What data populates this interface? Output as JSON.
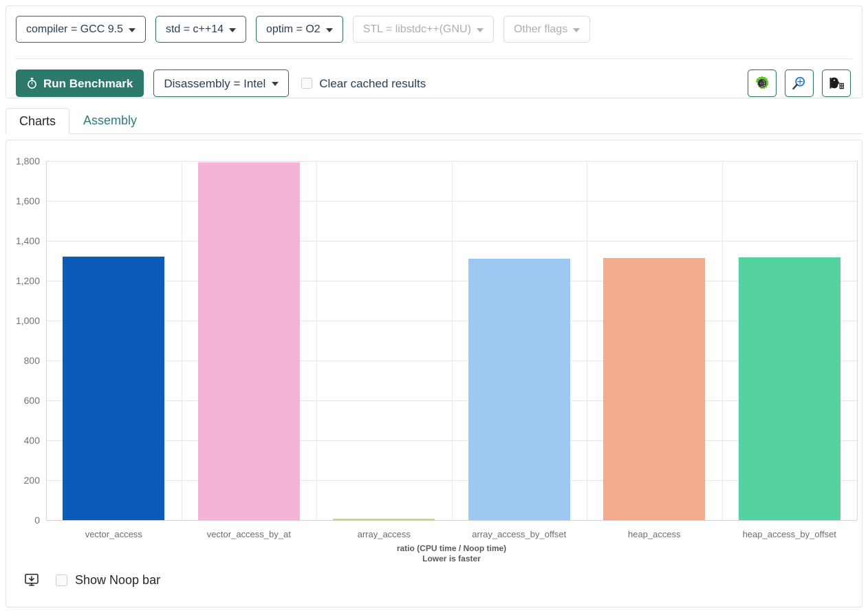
{
  "toolbar": {
    "flags": [
      {
        "label": "compiler = GCC 9.5",
        "name": "compiler-select",
        "muted": false
      },
      {
        "label": "std = c++14",
        "name": "std-select",
        "muted": false
      },
      {
        "label": "optim = O2",
        "name": "optim-select",
        "muted": false
      },
      {
        "label": "STL = libstdc++(GNU)",
        "name": "stl-select",
        "muted": true
      },
      {
        "label": "Other flags",
        "name": "other-flags-select",
        "muted": true
      }
    ],
    "run_label": "Run Benchmark",
    "disassembly_label": "Disassembly = Intel",
    "clear_cache_label": "Clear cached results",
    "clear_cache_checked": false,
    "icon_buttons": [
      {
        "name": "compiler-explorer-icon",
        "title": "Compiler Explorer"
      },
      {
        "name": "quick-bench-search-icon",
        "title": "Quick Bench"
      },
      {
        "name": "build-bench-beaver-icon",
        "title": "Build Bench"
      }
    ],
    "accent_color": "#2b7a6c",
    "outline_color": "#2b6b63"
  },
  "tabs": [
    {
      "label": "Charts",
      "active": true,
      "name": "tab-charts"
    },
    {
      "label": "Assembly",
      "active": false,
      "name": "tab-assembly"
    }
  ],
  "chart_data": {
    "type": "bar",
    "title": "",
    "xlabel": "ratio (CPU time / Noop time)",
    "xlabel_line2": "Lower is faster",
    "ylabel": "",
    "ylim": [
      0,
      1800
    ],
    "ytick_step": 200,
    "yticks": [
      "0",
      "200",
      "400",
      "600",
      "800",
      "1,000",
      "1,200",
      "1,400",
      "1,600",
      "1,800"
    ],
    "grid": true,
    "legend": "none",
    "categories": [
      "vector_access",
      "vector_access_by_at",
      "array_access",
      "array_access_by_offset",
      "heap_access",
      "heap_access_by_offset"
    ],
    "values": [
      1321,
      1794,
      3,
      1311,
      1315,
      1318
    ],
    "colors": [
      "#0b5cb8",
      "#f5b3d6",
      "#ccd385",
      "#9cc8f2",
      "#f3ab8e",
      "#54d3a0"
    ]
  },
  "footer": {
    "download_icon": "download-chart-icon",
    "noop_label": "Show Noop bar",
    "noop_checked": false
  }
}
